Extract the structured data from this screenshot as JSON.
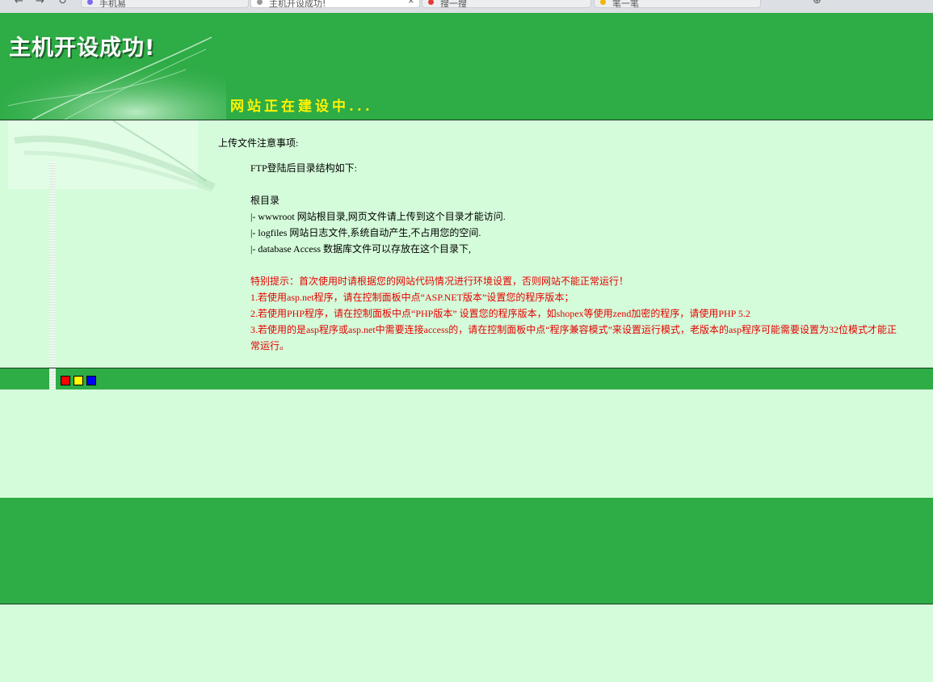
{
  "browser": {
    "tabs": [
      {
        "label": "手机易",
        "active": false,
        "favicon_color": "#7b6cf0"
      },
      {
        "label": "主机开设成功!",
        "active": true,
        "favicon_color": "#999999"
      },
      {
        "label": "搜一搜",
        "active": false,
        "favicon_color": "#e03a3a"
      },
      {
        "label": "笔一笔",
        "active": false,
        "favicon_color": "#f0b400"
      }
    ],
    "tab_close": "×"
  },
  "header": {
    "title": "主机开设成功!",
    "subtitle": "网站正在建设中..."
  },
  "notice": {
    "heading": "上传文件注意事项:",
    "ftp_intro": "FTP登陆后目录结构如下:",
    "root": "根目录",
    "dirs": [
      "|- wwwroot 网站根目录,网页文件请上传到这个目录才能访问.",
      "|- logfiles 网站日志文件,系统自动产生,不占用您的空间.",
      "|- database Access 数据库文件可以存放在这个目录下,"
    ],
    "tips": [
      "特别提示：首次使用时请根据您的网站代码情况进行环境设置，否则网站不能正常运行！",
      "1.若使用asp.net程序，请在控制面板中点“ASP.NET版本”设置您的程序版本；",
      "2.若使用PHP程序，请在控制面板中点“PHP版本” 设置您的程序版本，如shopex等使用zend加密的程序，请使用PHP 5.2",
      "3.若使用的是asp程序或asp.net中需要连接access的，请在控制面板中点“程序兼容模式”来设置运行模式，老版本的asp程序可能需要设置为32位模式才能正常运行。"
    ],
    "tip_color": "#e60000"
  },
  "colors": {
    "green": "#2eac46",
    "light_green": "#d4fcda",
    "squares": [
      "#ff0000",
      "#ffff00",
      "#0000ff"
    ]
  }
}
